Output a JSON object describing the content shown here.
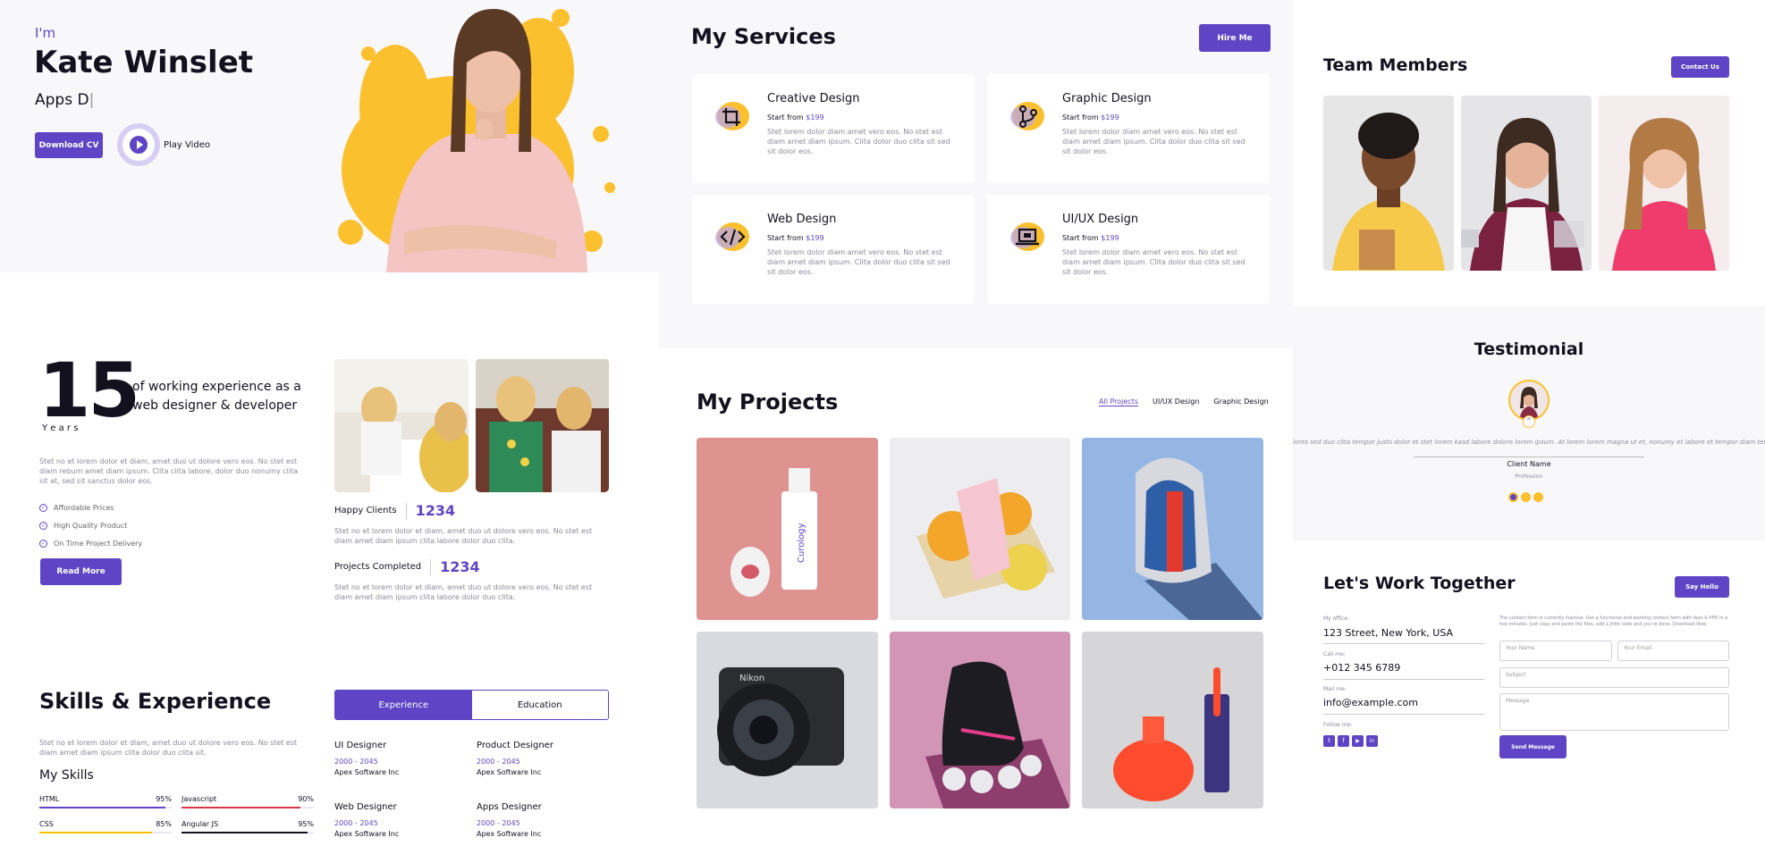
{
  "hero": {
    "greeting": "I'm",
    "name": "Kate Winslet",
    "typed": "Apps D",
    "download_label": "Download CV",
    "play_label": "Play Video"
  },
  "about": {
    "years_number": "15",
    "years_label": "Y e a r s",
    "experience_text": "of working experience as a web designer & developer",
    "desc": "Stet no et lorem dolor et diam, amet duo ut dolore vero eos. No stet est diam rebum amet diam ipsum. Clita clita labore, dolor duo nonumy clita sit at, sed sit sanctus dolor eos.",
    "features": [
      "Affordable Prices",
      "High Quality Product",
      "On Time Project Delivery"
    ],
    "read_more": "Read More",
    "stats": [
      {
        "label": "Happy Clients",
        "value": "1234",
        "desc": "Stet no et lorem dolor et diam, amet duo ut dolore vero eos. No stet est diam amet diam ipsum clita labore dolor duo clita."
      },
      {
        "label": "Projects Completed",
        "value": "1234",
        "desc": "Stet no et lorem dolor et diam, amet duo ut dolore vero eos. No stet est diam amet diam ipsum clita labore dolor duo clita."
      }
    ]
  },
  "skills": {
    "title": "Skills & Experience",
    "desc": "Stet no et lorem dolor et diam, amet duo ut dolore vero eos. No stet est diam amet diam ipsum clita dolor duo clita sit.",
    "my_skills": "My Skills",
    "items": [
      {
        "name": "HTML",
        "pct": "95%",
        "level": 95,
        "color": "#5f45c5"
      },
      {
        "name": "Javascript",
        "pct": "90%",
        "level": 90,
        "color": "#dc3545"
      },
      {
        "name": "CSS",
        "pct": "85%",
        "level": 85,
        "color": "#ffc107"
      },
      {
        "name": "Angular JS",
        "pct": "95%",
        "level": 95,
        "color": "#13111e"
      }
    ],
    "tabs": [
      "Experience",
      "Education"
    ],
    "jobs": [
      {
        "title": "UI Designer",
        "years": "2000 - 2045",
        "company": "Apex Software Inc"
      },
      {
        "title": "Product Designer",
        "years": "2000 - 2045",
        "company": "Apex Software Inc"
      },
      {
        "title": "Web Designer",
        "years": "2000 - 2045",
        "company": "Apex Software Inc"
      },
      {
        "title": "Apps Designer",
        "years": "2000 - 2045",
        "company": "Apex Software Inc"
      }
    ]
  },
  "services": {
    "title": "My Services",
    "hire": "Hire Me",
    "items": [
      {
        "name": "Creative Design",
        "from": "Start from",
        "price": "$199",
        "desc": "Stet lorem dolor diam amet vero eos. No stet est diam amet diam ipsum. Clita dolor duo clita sit sed sit dolor eos.",
        "icon": "crop-icon"
      },
      {
        "name": "Graphic Design",
        "from": "Start from",
        "price": "$199",
        "desc": "Stet lorem dolor diam amet vero eos. No stet est diam amet diam ipsum. Clita dolor duo clita sit sed sit dolor eos.",
        "icon": "branch-icon"
      },
      {
        "name": "Web Design",
        "from": "Start from",
        "price": "$199",
        "desc": "Stet lorem dolor diam amet vero eos. No stet est diam amet diam ipsum. Clita dolor duo clita sit sed sit dolor eos.",
        "icon": "code-icon"
      },
      {
        "name": "UI/UX Design",
        "from": "Start from",
        "price": "$199",
        "desc": "Stet lorem dolor diam amet vero eos. No stet est diam amet diam ipsum. Clita dolor duo clita sit sed sit dolor eos.",
        "icon": "laptop-icon"
      }
    ]
  },
  "projects": {
    "title": "My Projects",
    "filters": [
      "All Projects",
      "UI/UX Design",
      "Graphic Design"
    ]
  },
  "team": {
    "title": "Team Members",
    "contact": "Contact Us"
  },
  "testimonial": {
    "title": "Testimonial",
    "quote": "lores sed duo clita tempor justo dolor et stet lorem kasd labore dolore lorem ipsum. At lorem lorem magna ut et, nonumy et labore et tempor diam tempor ere",
    "client": "Client Name",
    "profession": "Profession"
  },
  "contact": {
    "title": "Let's Work Together",
    "say_hello": "Say Hello",
    "office_label": "My office:",
    "office": "123 Street, New York, USA",
    "call_label": "Call me:",
    "phone": "+012 345 6789",
    "mail_label": "Mail me:",
    "email": "info@example.com",
    "follow_label": "Follow me:",
    "form_note": "The contact form is currently inactive. Get a functional and working contact form with Ajax & PHP in a few minutes. Just copy and paste the files, add a little code and you're done. Download Now.",
    "name_ph": "Your Name",
    "email_ph": "Your Email",
    "subject_ph": "Subject",
    "message_ph": "Message",
    "send": "Send Message"
  },
  "colors": {
    "accent": "#5f45c5",
    "yellow": "#fbc02d",
    "bg_light": "#f8f8fb"
  }
}
